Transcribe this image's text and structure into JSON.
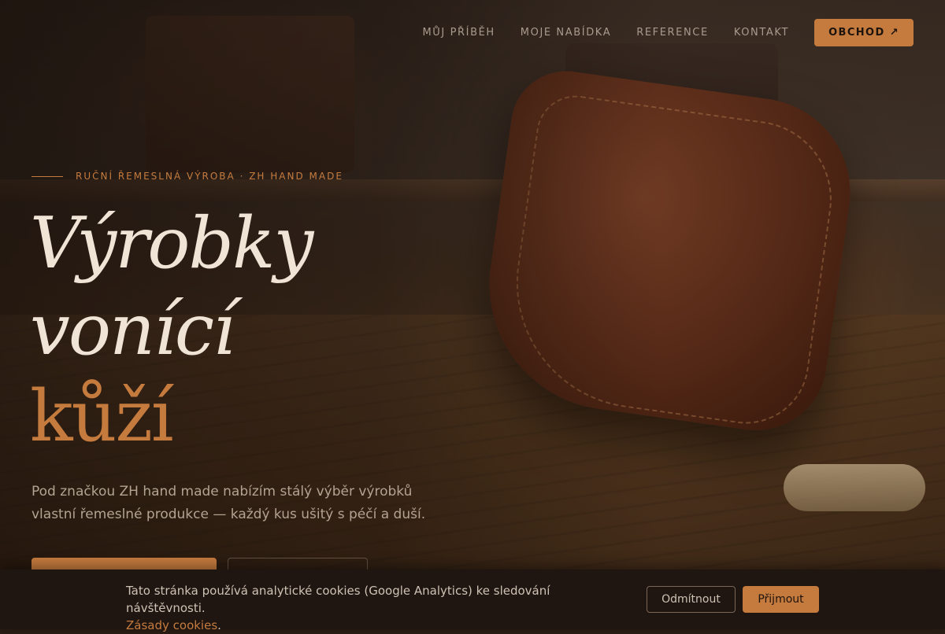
{
  "nav": {
    "items": [
      {
        "label": "MŮJ PŘÍBĚH"
      },
      {
        "label": "MOJE NABÍDKA"
      },
      {
        "label": "REFERENCE"
      },
      {
        "label": "KONTAKT"
      }
    ],
    "shop_label": "OBCHOD",
    "shop_icon": "↗"
  },
  "hero": {
    "eyebrow": "RUČNÍ ŘEMESLNÁ VÝROBA · ZH HAND MADE",
    "headline_line1": "Výrobky",
    "headline_line2": "vonící",
    "headline_accent": "kůží",
    "lead": "Pod značkou ZH hand made nabízím stálý výběr výrobků vlastní řemeslné produkce — každý kus ušitý s péčí a duší."
  },
  "cookie": {
    "text": "Tato stránka používá analytické cookies (Google Analytics) ke sledování návštěvnosti.",
    "policy_link": "Zásady cookies",
    "decline_label": "Odmítnout",
    "accept_label": "Přijmout"
  },
  "colors": {
    "accent": "#c67b3e",
    "background": "#2a1d15",
    "cookie_bar": "#1f1612",
    "headline": "#efe4d6"
  }
}
